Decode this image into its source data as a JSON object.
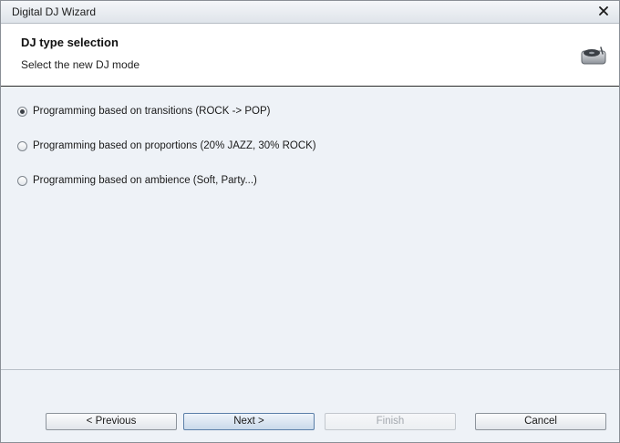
{
  "window": {
    "title": "Digital DJ Wizard",
    "close_glyph": "✕"
  },
  "header": {
    "title": "DJ type selection",
    "subtitle": "Select the new DJ mode",
    "icon": "turntable-icon"
  },
  "options": [
    {
      "label": "Programming based on transitions (ROCK -> POP)",
      "selected": true
    },
    {
      "label": "Programming based on proportions (20% JAZZ, 30% ROCK)",
      "selected": false
    },
    {
      "label": "Programming based on ambience (Soft, Party...)",
      "selected": false
    }
  ],
  "footer": {
    "previous": "< Previous",
    "next": "Next >",
    "finish": "Finish",
    "cancel": "Cancel",
    "finish_enabled": false
  },
  "colors": {
    "window_bg": "#eef2f7",
    "header_bg": "#ffffff",
    "accent": "#5b7fa8"
  }
}
